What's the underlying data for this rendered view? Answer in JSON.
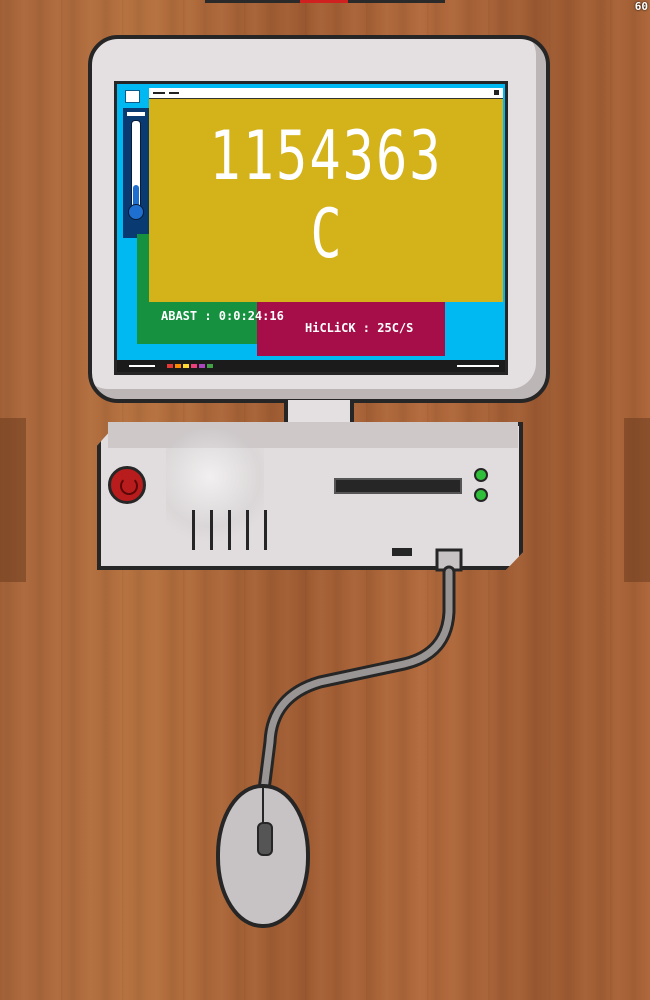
{
  "hud": {
    "fps": "60"
  },
  "screen": {
    "counter_value": "1154363",
    "counter_unit": "C",
    "stats": {
      "abast": "ABAST : 0:0:24:16",
      "hiclick": "HiCLiCK : 25C/S"
    }
  },
  "icons": [
    "desktop-icon",
    "thermometer-icon",
    "power-icon",
    "fan-icon",
    "mouse-icon"
  ],
  "colors": {
    "window": "#d3b21a",
    "desktop": "#00b9f3",
    "green_card": "#159140",
    "red_card": "#a50e49",
    "power_button": "#b81c1c",
    "led": "#2fbf3a"
  }
}
